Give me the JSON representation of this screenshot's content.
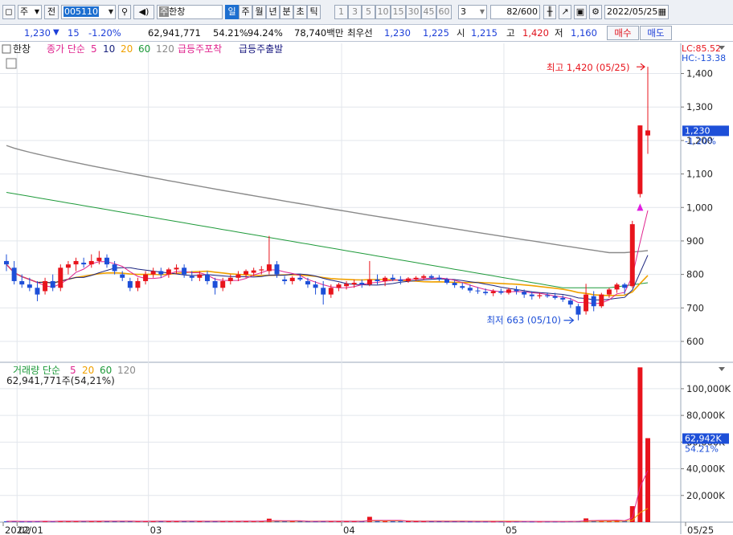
{
  "toolbar": {
    "type_label": "주",
    "price_type": "전",
    "code": "005110",
    "stock_name_badge": "주",
    "stock_name": "한창",
    "periods": [
      "일",
      "주",
      "월",
      "년",
      "분",
      "초",
      "틱"
    ],
    "active_period": "일",
    "intervals": [
      "1",
      "3",
      "5",
      "10",
      "15",
      "30",
      "45",
      "60"
    ],
    "interval_select": "3",
    "count": "82",
    "count_total": "/600",
    "date": "2022/05/25"
  },
  "quote": {
    "price": "1,230",
    "change": "15",
    "change_pct": "-1.20%",
    "volume": "62,941,771",
    "volume_ratio": "54.21%",
    "turnover": "94.24%",
    "amount": "78,740백만",
    "best_ask_label": "최우선",
    "best_ask": "1,230",
    "best_bid": "1,225",
    "open_label": "시",
    "open": "1,215",
    "high_label": "고",
    "high": "1,420",
    "low_label": "저",
    "low": "1,160",
    "buy_button": "매수",
    "sell_button": "매도"
  },
  "colors": {
    "up": "#e8141c",
    "down": "#1d4fd8",
    "ma5": "#e0258f",
    "ma10": "#1a237e",
    "ma20": "#f0a100",
    "ma60": "#1e9a3a",
    "ma120": "#8a8a8a",
    "pos_signal": "#e01ee0"
  },
  "chart_data": [
    {
      "type": "candlestick",
      "name_tag": "한창",
      "legend": {
        "label": "종가 단순",
        "periods": [
          "5",
          "10",
          "20",
          "60",
          "120"
        ],
        "signals": [
          "급등주포착",
          "급등주출발"
        ]
      },
      "lc_label": "LC:85.52",
      "hc_label": "HC:-13.38",
      "ylim": [
        540,
        1490
      ],
      "yticks": [
        "1,400",
        "1,300",
        "1,200",
        "1,100",
        "1,000",
        "900",
        "800",
        "700",
        "600"
      ],
      "ytick_values": [
        1400,
        1300,
        1200,
        1100,
        1000,
        900,
        800,
        700,
        600
      ],
      "current_price_label": "1,230",
      "current_change_label": "-1.20%",
      "high_annotation": "최고 1,420 (05/25)",
      "low_annotation": "최저 663 (05/10)",
      "x_labels": [
        "2022/01",
        "02",
        "03",
        "04",
        "05",
        "05/25"
      ],
      "ohlc": [
        [
          840,
          860,
          810,
          830
        ],
        [
          820,
          840,
          770,
          780
        ],
        [
          780,
          800,
          760,
          770
        ],
        [
          770,
          790,
          750,
          760
        ],
        [
          760,
          780,
          720,
          740
        ],
        [
          750,
          790,
          740,
          780
        ],
        [
          780,
          800,
          750,
          760
        ],
        [
          760,
          830,
          750,
          820
        ],
        [
          820,
          840,
          800,
          830
        ],
        [
          830,
          850,
          810,
          840
        ],
        [
          835,
          850,
          820,
          830
        ],
        [
          830,
          860,
          820,
          840
        ],
        [
          840,
          870,
          830,
          850
        ],
        [
          850,
          860,
          820,
          830
        ],
        [
          830,
          840,
          800,
          810
        ],
        [
          800,
          810,
          780,
          790
        ],
        [
          780,
          790,
          750,
          760
        ],
        [
          760,
          790,
          750,
          780
        ],
        [
          780,
          810,
          770,
          800
        ],
        [
          800,
          820,
          790,
          810
        ],
        [
          810,
          820,
          790,
          800
        ],
        [
          800,
          820,
          790,
          815
        ],
        [
          815,
          830,
          800,
          820
        ],
        [
          820,
          830,
          790,
          800
        ],
        [
          795,
          810,
          780,
          790
        ],
        [
          790,
          810,
          780,
          800
        ],
        [
          800,
          810,
          770,
          780
        ],
        [
          780,
          790,
          740,
          760
        ],
        [
          760,
          790,
          750,
          780
        ],
        [
          780,
          800,
          770,
          790
        ],
        [
          790,
          810,
          780,
          800
        ],
        [
          800,
          815,
          790,
          810
        ],
        [
          805,
          820,
          795,
          812
        ],
        [
          812,
          825,
          800,
          815
        ],
        [
          810,
          915,
          800,
          830
        ],
        [
          830,
          840,
          790,
          800
        ],
        [
          785,
          795,
          770,
          780
        ],
        [
          780,
          795,
          770,
          790
        ],
        [
          790,
          800,
          780,
          785
        ],
        [
          780,
          790,
          760,
          770
        ],
        [
          770,
          780,
          740,
          760
        ],
        [
          760,
          780,
          710,
          740
        ],
        [
          740,
          770,
          730,
          760
        ],
        [
          760,
          775,
          750,
          770
        ],
        [
          765,
          780,
          755,
          772
        ],
        [
          770,
          785,
          760,
          775
        ],
        [
          775,
          785,
          760,
          770
        ],
        [
          770,
          840,
          765,
          785
        ],
        [
          785,
          800,
          770,
          780
        ],
        [
          780,
          795,
          765,
          790
        ],
        [
          790,
          800,
          780,
          785
        ],
        [
          785,
          795,
          770,
          780
        ],
        [
          780,
          792,
          775,
          788
        ],
        [
          785,
          795,
          780,
          790
        ],
        [
          790,
          800,
          783,
          795
        ],
        [
          795,
          800,
          785,
          790
        ],
        [
          790,
          798,
          780,
          785
        ],
        [
          785,
          790,
          770,
          775
        ],
        [
          775,
          782,
          760,
          768
        ],
        [
          765,
          775,
          755,
          760
        ],
        [
          760,
          770,
          745,
          752
        ],
        [
          752,
          762,
          742,
          750
        ],
        [
          748,
          758,
          738,
          744
        ],
        [
          744,
          756,
          735,
          750
        ],
        [
          750,
          758,
          740,
          745
        ],
        [
          745,
          760,
          740,
          755
        ],
        [
          755,
          765,
          740,
          750
        ],
        [
          748,
          755,
          730,
          740
        ],
        [
          740,
          750,
          725,
          735
        ],
        [
          735,
          745,
          728,
          738
        ],
        [
          738,
          746,
          730,
          735
        ],
        [
          735,
          745,
          725,
          730
        ],
        [
          730,
          738,
          718,
          725
        ],
        [
          722,
          730,
          700,
          710
        ],
        [
          705,
          712,
          663,
          680
        ],
        [
          690,
          772,
          680,
          740
        ],
        [
          735,
          750,
          690,
          705
        ],
        [
          705,
          745,
          700,
          740
        ],
        [
          740,
          760,
          730,
          755
        ],
        [
          755,
          775,
          745,
          770
        ],
        [
          770,
          775,
          740,
          760
        ],
        [
          765,
          960,
          760,
          950
        ],
        [
          1040,
          1245,
          1030,
          1245
        ],
        [
          1215,
          1420,
          1160,
          1230
        ]
      ],
      "volume_panel": {
        "label": "거래량 단순",
        "periods": [
          "5",
          "20",
          "60",
          "120"
        ],
        "info": "62,941,771주(54,21%)",
        "yticks": [
          "100,000K",
          "80,000K",
          "60,000K",
          "40,000K",
          "20,000K"
        ],
        "ytick_values": [
          100000,
          80000,
          60000,
          40000,
          20000
        ],
        "ylim": [
          0,
          118000
        ],
        "current_label": "62,942K",
        "current_pct": "54.21%",
        "volumes_k": [
          600,
          700,
          500,
          500,
          800,
          700,
          600,
          900,
          800,
          700,
          700,
          800,
          900,
          700,
          600,
          600,
          700,
          600,
          700,
          800,
          700,
          800,
          800,
          700,
          600,
          700,
          600,
          600,
          700,
          700,
          800,
          700,
          700,
          700,
          2600,
          900,
          600,
          600,
          700,
          600,
          600,
          800,
          700,
          600,
          600,
          600,
          600,
          4000,
          800,
          700,
          700,
          600,
          700,
          600,
          700,
          600,
          600,
          600,
          600,
          600,
          500,
          500,
          500,
          500,
          500,
          500,
          500,
          600,
          500,
          500,
          500,
          500,
          500,
          600,
          800,
          2800,
          1400,
          1000,
          1000,
          1200,
          1000,
          12000,
          116000,
          62942
        ]
      }
    }
  ]
}
